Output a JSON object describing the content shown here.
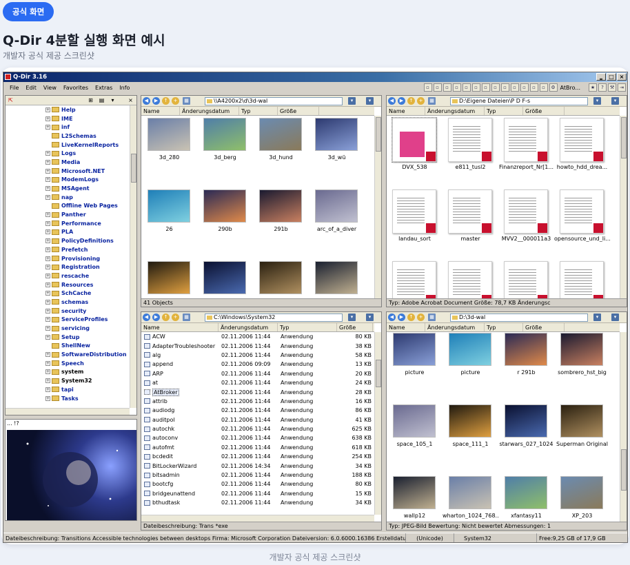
{
  "page": {
    "badge": "공식 화면",
    "title": "Q-Dir 4분할 실행 화면 예시",
    "subtitle": "개발자 공식 제공 스크린샷",
    "caption": "개발자 공식 제공 스크린샷"
  },
  "window": {
    "title": "Q-Dir 3.16",
    "menu": [
      "File",
      "Edit",
      "View",
      "Favorites",
      "Extras",
      "Info"
    ],
    "toolbar_right": "AtBro..."
  },
  "tree": {
    "items": [
      "Help",
      "IME",
      "inf",
      "L2Schemas",
      "LiveKernelReports",
      "Logs",
      "Media",
      "Microsoft.NET",
      "ModemLogs",
      "MSAgent",
      "nap",
      "Offline Web Pages",
      "Panther",
      "Performance",
      "PLA",
      "PolicyDefinitions",
      "Prefetch",
      "Provisioning",
      "Registration",
      "rescache",
      "Resources",
      "SchCache",
      "schemas",
      "security",
      "ServiceProfiles",
      "servicing",
      "Setup",
      "ShellNew",
      "SoftwareDistribution",
      "Speech",
      "system",
      "System32",
      "tapi",
      "Tasks"
    ],
    "preview_label": "... !?"
  },
  "pane_tl": {
    "path": "\\\\A4200x2\\d\\3d-wal",
    "columns": [
      "Name",
      "Änderungsdatum",
      "Typ",
      "Größe"
    ],
    "thumbs": [
      "3d_280",
      "3d_berg",
      "3d_hund",
      "3d_wü",
      "26",
      "290b",
      "291b",
      "arc_of_a_diver",
      "",
      "",
      "",
      ""
    ],
    "status": "41 Objects"
  },
  "pane_tr": {
    "path": "D:\\Eigene Dateien\\P D F-s",
    "columns": [
      "Name",
      "Änderungsdatum",
      "Typ",
      "Größe"
    ],
    "docs": [
      "DVX_538",
      "e811_tusl2",
      "Finanzreport_Nr[1...",
      "howto_hdd_drea...",
      "landau_sort",
      "master",
      "MVV2__000011a3",
      "opensource_und_li...",
      "",
      "",
      "",
      ""
    ],
    "status": "Typ: Adobe Acrobat Document Größe: 78,7 KB Änderungsc"
  },
  "pane_bl": {
    "path": "C:\\Windows\\System32",
    "columns": [
      "Name",
      "Änderungsdatum",
      "Typ",
      "Größe"
    ],
    "rows": [
      {
        "name": "ACW",
        "date": "02.11.2006 11:44",
        "type": "Anwendung",
        "size": "80 KB"
      },
      {
        "name": "AdapterTroubleshooter",
        "date": "02.11.2006 11:44",
        "type": "Anwendung",
        "size": "38 KB"
      },
      {
        "name": "alg",
        "date": "02.11.2006 11:44",
        "type": "Anwendung",
        "size": "58 KB"
      },
      {
        "name": "append",
        "date": "02.11.2006 09:09",
        "type": "Anwendung",
        "size": "13 KB"
      },
      {
        "name": "ARP",
        "date": "02.11.2006 11:44",
        "type": "Anwendung",
        "size": "20 KB"
      },
      {
        "name": "at",
        "date": "02.11.2006 11:44",
        "type": "Anwendung",
        "size": "24 KB"
      },
      {
        "name": "AtBroker",
        "date": "02.11.2006 11:44",
        "type": "Anwendung",
        "size": "28 KB"
      },
      {
        "name": "attrib",
        "date": "02.11.2006 11:44",
        "type": "Anwendung",
        "size": "16 KB"
      },
      {
        "name": "audiodg",
        "date": "02.11.2006 11:44",
        "type": "Anwendung",
        "size": "86 KB"
      },
      {
        "name": "auditpol",
        "date": "02.11.2006 11:44",
        "type": "Anwendung",
        "size": "41 KB"
      },
      {
        "name": "autochk",
        "date": "02.11.2006 11:44",
        "type": "Anwendung",
        "size": "625 KB"
      },
      {
        "name": "autoconv",
        "date": "02.11.2006 11:44",
        "type": "Anwendung",
        "size": "638 KB"
      },
      {
        "name": "autofmt",
        "date": "02.11.2006 11:44",
        "type": "Anwendung",
        "size": "618 KB"
      },
      {
        "name": "bcdedit",
        "date": "02.11.2006 11:44",
        "type": "Anwendung",
        "size": "254 KB"
      },
      {
        "name": "BitLockerWizard",
        "date": "02.11.2006 14:34",
        "type": "Anwendung",
        "size": "34 KB"
      },
      {
        "name": "bitsadmin",
        "date": "02.11.2006 11:44",
        "type": "Anwendung",
        "size": "188 KB"
      },
      {
        "name": "bootcfg",
        "date": "02.11.2006 11:44",
        "type": "Anwendung",
        "size": "80 KB"
      },
      {
        "name": "bridgeunattend",
        "date": "02.11.2006 11:44",
        "type": "Anwendung",
        "size": "15 KB"
      },
      {
        "name": "bthudtask",
        "date": "02.11.2006 11:44",
        "type": "Anwendung",
        "size": "34 KB"
      }
    ],
    "status": "Dateibeschreibung: Trans *exe"
  },
  "pane_br": {
    "path": "D:\\3d-wal",
    "columns": [
      "Name",
      "Änderungsdatum",
      "Typ",
      "Größe"
    ],
    "thumbs": [
      "picture",
      "picture",
      "r 291b",
      "sombrero_hst_big",
      "space_105_1",
      "space_111_1",
      "starwars_027_1024",
      "Superman Original",
      "wallp12",
      "wharton_1024_768...",
      "xfantasy11",
      "XP_203"
    ],
    "status": "Typ: JPEG-Bild Bewertung: Nicht bewertet Abmessungen: 1"
  },
  "statusbar": {
    "desc": "Dateibeschreibung: Transitions Accessible technologies between desktops Firma: Microsoft Corporation Dateiversion: 6.0.6000.16386 Erstelldatum: 02.11.2006",
    "encoding": "(Unicode)",
    "folder": "System32",
    "free": "Free:9,25 GB of 17,9 GB"
  },
  "colors": {
    "accent": "#2b6bf2",
    "titlebar": "#0a246a",
    "tree_link": "#0a24a0",
    "pdf": "#c8102e"
  }
}
